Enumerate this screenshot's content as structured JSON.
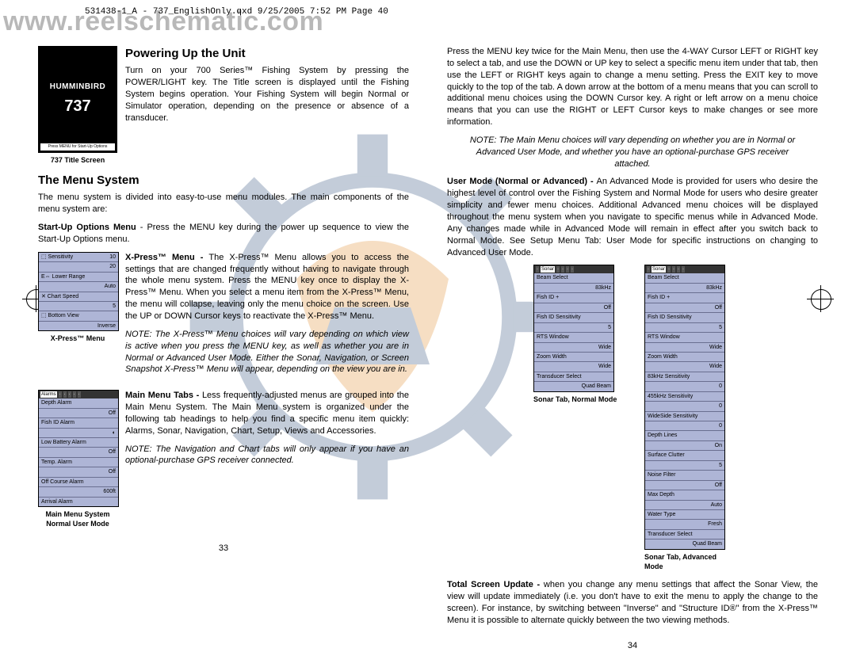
{
  "watermark": "www.reelschematic.com",
  "runhead": "531438-1_A - 737_EnglishOnly.qxd  9/25/2005  7:52 PM  Page 40",
  "title_screen": {
    "brand": "HUMMINBIRD",
    "model": "737",
    "bar": "Press MENU for Start-Up Options",
    "caption": "737 Title Screen"
  },
  "left": {
    "h_power": "Powering Up the Unit",
    "p_power": "Turn on your 700 Series™ Fishing System by pressing the POWER/LIGHT key. The Title screen is displayed until the Fishing System begins operation. Your Fishing System will begin Normal or Simulator operation, depending on the presence or absence of a transducer.",
    "h_menu": "The Menu System",
    "p_menu_intro": "The menu system is divided into easy-to-use menu modules. The main components of the menu system are:",
    "p_startup": "Start-Up Options Menu - Press the MENU key during the power up sequence to view the Start-Up Options menu.",
    "xpress": {
      "label": "X-Press™ Menu - ",
      "body": "The X-Press™ Menu allows you to access the settings that are changed frequently without having to navigate through the whole menu system. Press the MENU key once to display the X-Press™ Menu. When you select a menu item from the X-Press™ Menu, the menu will collapse, leaving only the menu choice on the screen. Use the UP or DOWN Cursor keys to reactivate the X-Press™ Menu.",
      "note": "NOTE: The X-Press™ Menu choices will vary depending on which view is active when you press the MENU key, as well as whether you are in Normal or Advanced User Mode. Either the Sonar, Navigation, or Screen Snapshot X-Press™ Menu will appear, depending on the view you are in.",
      "caption": "X-Press™ Menu",
      "rows": [
        {
          "l": "⬚ Sensitivity",
          "r": "10"
        },
        {
          "l": "",
          "r": "20"
        },
        {
          "l": "E⇔ Lower Range",
          "r": ""
        },
        {
          "l": "",
          "r": "Auto"
        },
        {
          "l": "✕ Chart Speed",
          "r": ""
        },
        {
          "l": "",
          "r": "5"
        },
        {
          "l": "⬚ Bottom View",
          "r": ""
        },
        {
          "l": "",
          "r": "Inverse"
        }
      ]
    },
    "mainmenu": {
      "label": "Main Menu Tabs - ",
      "body": "Less frequently-adjusted menus are grouped into the Main Menu System. The Main Menu system is organized under the following tab headings to help you find a specific menu item quickly: Alarms, Sonar, Navigation, Chart, Setup, Views and Accessories.",
      "note": "NOTE: The Navigation and Chart tabs will only appear if you have an optional-purchase GPS receiver connected.",
      "caption": "Main Menu System\nNormal User Mode",
      "tabs": [
        "Alarms",
        "·",
        "·",
        "·",
        "·",
        "·",
        "·"
      ],
      "rows": [
        {
          "l": "Depth Alarm",
          "r": ""
        },
        {
          "l": "",
          "r": "Off"
        },
        {
          "l": "Fish ID Alarm",
          "r": ""
        },
        {
          "l": "",
          "r": "◐"
        },
        {
          "l": "Low Battery Alarm",
          "r": ""
        },
        {
          "l": "",
          "r": "Off"
        },
        {
          "l": "Temp. Alarm",
          "r": ""
        },
        {
          "l": "",
          "r": "Off"
        },
        {
          "l": "Off Course Alarm",
          "r": ""
        },
        {
          "l": "",
          "r": "600ft"
        },
        {
          "l": "Arrival Alarm",
          "r": ""
        }
      ]
    },
    "pagenum": "33"
  },
  "right": {
    "p_press": "Press the MENU key twice for the Main Menu, then use the 4-WAY Cursor LEFT or RIGHT key to select a tab, and use the DOWN or UP key to select a specific menu item under that tab, then use the LEFT or RIGHT keys again to change a menu setting. Press the EXIT key to move quickly to the top of the tab. A down arrow at the bottom of a menu means that you can scroll to additional menu choices using the DOWN Cursor key. A right or left arrow on a menu choice means that you can use the RIGHT or LEFT Cursor keys to make changes or see more information.",
    "note1": "NOTE: The Main Menu choices will vary depending on whether you are in Normal or Advanced User Mode, and whether you have an optional-purchase GPS receiver attached.",
    "p_usermode_label": "User Mode (Normal or Advanced) - ",
    "p_usermode": "An Advanced Mode is provided for users who desire the highest level of control over the Fishing System and Normal Mode for users who desire greater simplicity and fewer menu choices. Additional Advanced menu choices will be displayed throughout the menu system when you navigate to specific menus while in Advanced Mode. Any changes made while in Advanced Mode will remain in effect after you switch back to Normal Mode. See Setup Menu Tab: User Mode for specific instructions on changing to Advanced User Mode.",
    "sonar_normal": {
      "caption": "Sonar Tab, Normal Mode",
      "rows": [
        {
          "l": "Beam Select",
          "r": ""
        },
        {
          "l": "",
          "r": "83kHz"
        },
        {
          "l": "Fish ID +",
          "r": ""
        },
        {
          "l": "",
          "r": "Off"
        },
        {
          "l": "Fish ID Sensitivity",
          "r": ""
        },
        {
          "l": "",
          "r": "5"
        },
        {
          "l": "RTS Window",
          "r": ""
        },
        {
          "l": "",
          "r": "Wide"
        },
        {
          "l": "Zoom Width",
          "r": ""
        },
        {
          "l": "",
          "r": "Wide"
        },
        {
          "l": "Transducer Select",
          "r": ""
        },
        {
          "l": "",
          "r": "Quad Beam"
        }
      ]
    },
    "sonar_adv": {
      "caption": "Sonar Tab, Advanced Mode",
      "rows": [
        {
          "l": "Beam Select",
          "r": ""
        },
        {
          "l": "",
          "r": "83kHz"
        },
        {
          "l": "Fish ID +",
          "r": ""
        },
        {
          "l": "",
          "r": "Off"
        },
        {
          "l": "Fish ID Sensitivity",
          "r": ""
        },
        {
          "l": "",
          "r": "5"
        },
        {
          "l": "RTS Window",
          "r": ""
        },
        {
          "l": "",
          "r": "Wide"
        },
        {
          "l": "Zoom Width",
          "r": ""
        },
        {
          "l": "",
          "r": "Wide"
        },
        {
          "l": "83kHz Sensitivity",
          "r": ""
        },
        {
          "l": "",
          "r": "0"
        },
        {
          "l": "455kHz Sensitivity",
          "r": ""
        },
        {
          "l": "",
          "r": "0"
        },
        {
          "l": "WideSide Sensitivity",
          "r": ""
        },
        {
          "l": "",
          "r": "0"
        },
        {
          "l": "Depth Lines",
          "r": ""
        },
        {
          "l": "",
          "r": "On"
        },
        {
          "l": "Surface Clutter",
          "r": ""
        },
        {
          "l": "",
          "r": "5"
        },
        {
          "l": "Noise Filter",
          "r": ""
        },
        {
          "l": "",
          "r": "Off"
        },
        {
          "l": "Max Depth",
          "r": ""
        },
        {
          "l": "",
          "r": "Auto"
        },
        {
          "l": "Water Type",
          "r": ""
        },
        {
          "l": "",
          "r": "Fresh"
        },
        {
          "l": "Transducer Select",
          "r": ""
        },
        {
          "l": "",
          "r": "Quad Beam"
        }
      ]
    },
    "p_total_label": "Total Screen Update - ",
    "p_total": "when you change any menu settings that affect the Sonar View, the view will update immediately (i.e. you don't have to exit the menu to apply the change to the screen). For instance, by switching between \"Inverse\" and \"Structure ID®\" from the X-Press™ Menu it is possible to alternate quickly between the two viewing methods.",
    "pagenum": "34"
  }
}
